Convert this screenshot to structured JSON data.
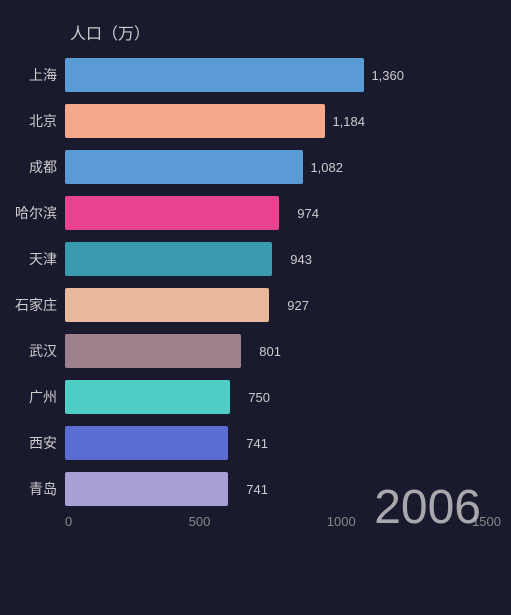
{
  "chart": {
    "title": "人口（万）",
    "year": "2006",
    "maxValue": 1500,
    "chartWidth": 330,
    "bars": [
      {
        "label": "上海",
        "value": 1360,
        "color": "#5b9bd5"
      },
      {
        "label": "北京",
        "value": 1184,
        "color": "#f4a78a"
      },
      {
        "label": "成都",
        "value": 1082,
        "color": "#5b9bd5"
      },
      {
        "label": "哈尔滨",
        "value": 974,
        "color": "#e84393"
      },
      {
        "label": "天津",
        "value": 943,
        "color": "#3a9ab0"
      },
      {
        "label": "石家庄",
        "value": 927,
        "color": "#e8b89a"
      },
      {
        "label": "武汉",
        "value": 801,
        "color": "#9e7f8c"
      },
      {
        "label": "广州",
        "value": 750,
        "color": "#4ecdc4"
      },
      {
        "label": "西安",
        "value": 741,
        "color": "#5b6dd5"
      },
      {
        "label": "青岛",
        "value": 741,
        "color": "#a89fd5"
      }
    ],
    "xAxis": {
      "ticks": [
        "0",
        "500",
        "1000",
        "1500"
      ]
    }
  }
}
